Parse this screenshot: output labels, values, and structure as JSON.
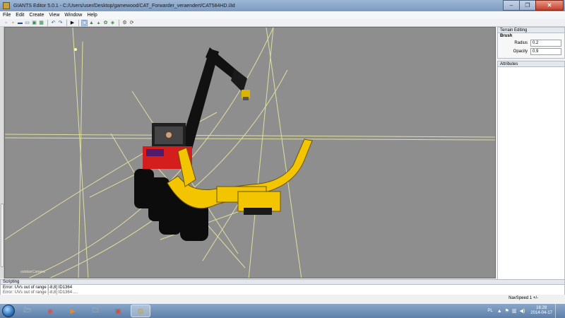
{
  "window": {
    "title": "GIANTS Editor 5.0.1 - C:/Users/user/Desktop/gamewood/CAT_Forwarder_veraendert/CAT584HD.i3d",
    "minimize_glyph": "–",
    "maximize_glyph": "❐",
    "close_glyph": "✕"
  },
  "menu": {
    "items": [
      "File",
      "Edit",
      "Create",
      "View",
      "Window",
      "Help"
    ]
  },
  "toolbar": {
    "icons": [
      "new-file-icon",
      "open-file-icon",
      "save-icon",
      "save-as-icon",
      "import-icon",
      "export-icon",
      "undo-icon",
      "redo-icon",
      "play-icon",
      "select-icon",
      "terrain-sculpt-icon",
      "terrain-paint-icon",
      "foliage-paint-icon",
      "scene-tree-icon",
      "settings-icon",
      "refresh-icon"
    ],
    "glyphs": [
      "▫",
      "▪",
      "▬",
      "▭",
      "▣",
      "▦",
      "↶",
      "↷",
      "▶",
      "▢",
      "▲",
      "▴",
      "✿",
      "◈",
      "⚙",
      "⟳"
    ]
  },
  "viewport": {
    "camera_label": "outdoorCamera",
    "accent_color": "#e8e8a0",
    "machine_yellow": "#f2c500",
    "machine_red": "#d41e1e"
  },
  "terrain_editing": {
    "title": "Terrain Editing",
    "brush_label": "Brush",
    "radius_label": "Radius",
    "radius_value": "0.2",
    "opacity_label": "Opacity",
    "opacity_value": "0.9"
  },
  "attributes": {
    "title": "Attributes"
  },
  "scripting": {
    "title": "Scripting",
    "lines": [
      "Error: UVs out of range [-8,8] ID1364",
      "Error: UVs out of range [-8,8] ID1364 ...."
    ]
  },
  "status": {
    "navspeed": "NavSpeed 1 +/-"
  },
  "taskbar": {
    "language": "PL",
    "time": "16:28",
    "date": "2014-04-17",
    "apps": [
      {
        "name": "explorer",
        "glyph": "🗁"
      },
      {
        "name": "chrome",
        "glyph": "◉"
      },
      {
        "name": "media-player",
        "glyph": "▶"
      },
      {
        "name": "folder",
        "glyph": "🗀"
      },
      {
        "name": "image-viewer",
        "glyph": "▣"
      },
      {
        "name": "giants-editor",
        "glyph": "▤"
      }
    ]
  }
}
